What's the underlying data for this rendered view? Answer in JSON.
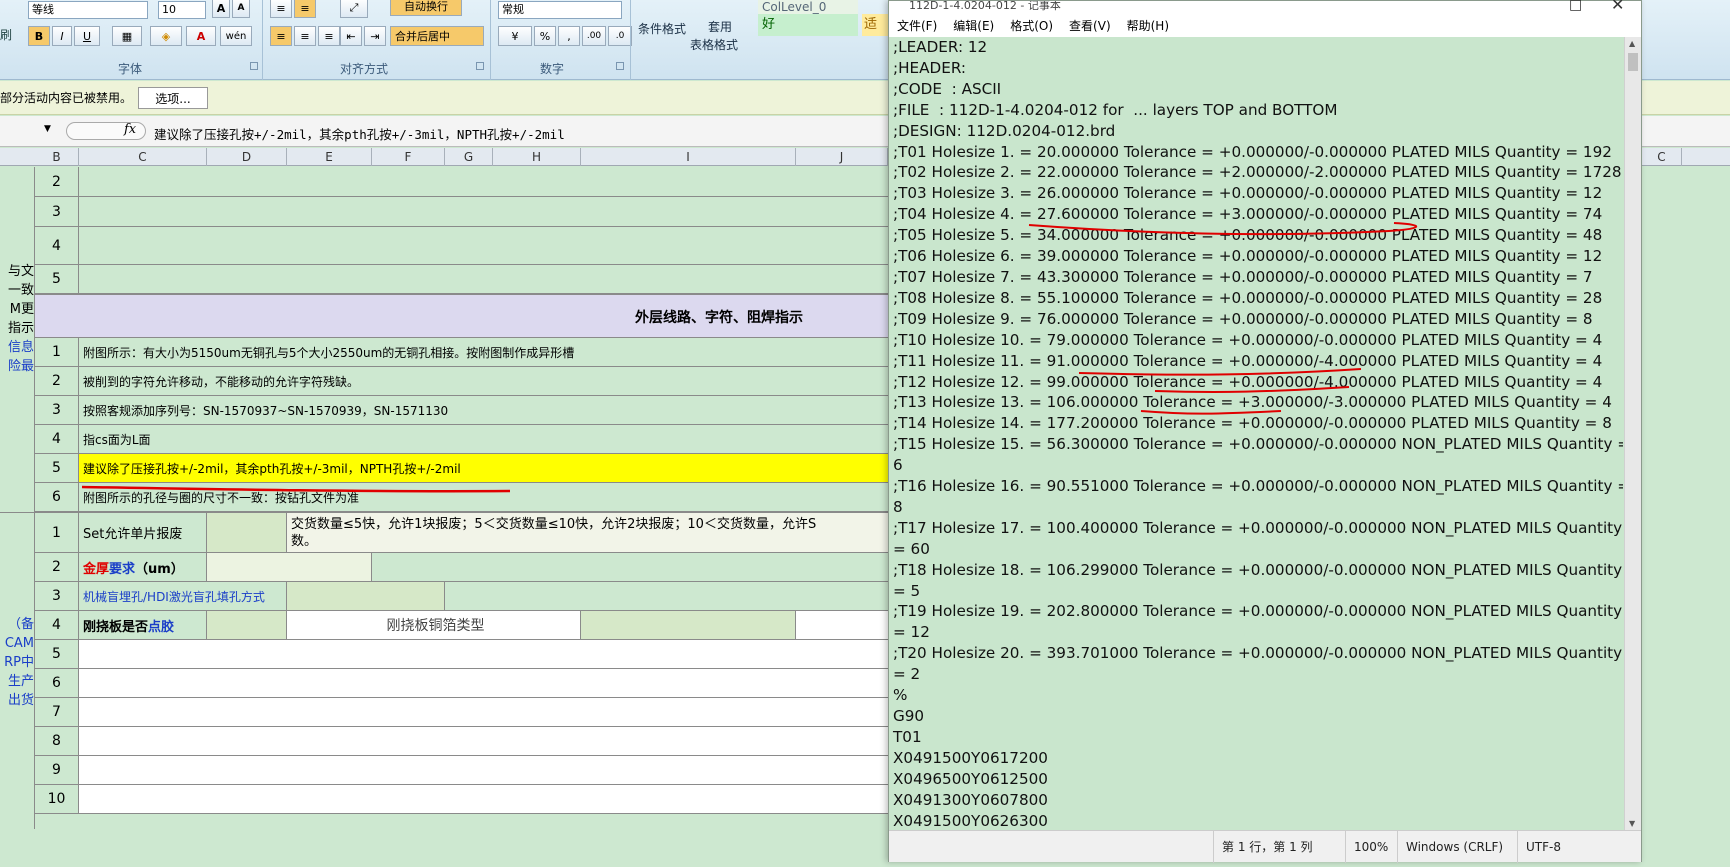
{
  "ribbon": {
    "font_name": "等线",
    "font_size": "10",
    "number_format": "常规",
    "wrap_text": "自动换行",
    "merge_center": "合并后居中",
    "conditional_format": "条件格式",
    "apply": "套用",
    "table_format": "表格格式",
    "style_name": "ColLevel_0",
    "style_good": "好",
    "style_fit": "适中",
    "brush": "刷",
    "group_font": "字体",
    "group_align": "对齐方式",
    "group_number": "数字",
    "bold": "B",
    "italic": "I",
    "underline": "U",
    "grow": "A",
    "shrink": "A",
    "percent": "%",
    "comma": ","
  },
  "message_bar": {
    "text": "部分活动内容已被禁用。",
    "options_button": "选项..."
  },
  "formula_bar": {
    "fx": "fx",
    "content": "建议除了压接孔按+/-2mil，其余pth孔按+/-3mil，NPTH孔按+/-2mil"
  },
  "columns": [
    "B",
    "C",
    "D",
    "E",
    "F",
    "G",
    "H",
    "I",
    "J",
    "C"
  ],
  "left_clip_text": {
    "block1": [
      "与文",
      "一致",
      "M更",
      "指示",
      "信息",
      "险最"
    ],
    "block2": [
      "（备",
      "CAM",
      "RP中",
      "生产",
      "出货"
    ]
  },
  "sheet": {
    "top_rows": [
      "2",
      "3",
      "4",
      "5"
    ],
    "section_title": "外层线路、字符、阻焊指示",
    "section_rows": [
      {
        "num": "1",
        "text": "附图所示：有大小为5150um无铜孔与5个大小2550um的无铜孔相接。按附图制作成异形槽"
      },
      {
        "num": "2",
        "text": "被削到的字符允许移动，不能移动的允许字符残缺。"
      },
      {
        "num": "3",
        "text": "按照客规添加序列号：SN-1570937~SN-1570939，SN-1571130"
      },
      {
        "num": "4",
        "text": "指cs面为L面"
      },
      {
        "num": "5",
        "text": "建议除了压接孔按+/-2mil，其余pth孔按+/-3mil，NPTH孔按+/-2mil"
      },
      {
        "num": "6",
        "text": "附图所示的孔径与圈的尺寸不一致：按钻孔文件为准"
      }
    ],
    "lower_rows": [
      {
        "num": "1",
        "label": "Set允许单片报废",
        "value": "交货数量≤5快，允许1块报废；5＜交货数量≤10快，允许2块报废；10＜交货数量，允许S",
        "value2": "数。"
      },
      {
        "num": "2",
        "label_red": "金厚",
        "label_blue": "要求",
        "label_rest": "（um）"
      },
      {
        "num": "3",
        "label": "机械盲埋孔/HDI激光盲孔填孔方式"
      },
      {
        "num": "4",
        "label_a": "刚挠板是否",
        "label_b": "点胶",
        "mid": "刚挠板铜箔类型"
      },
      {
        "num": "5"
      },
      {
        "num": "6"
      },
      {
        "num": "7"
      },
      {
        "num": "8"
      },
      {
        "num": "9"
      },
      {
        "num": "10"
      }
    ]
  },
  "notepad": {
    "title": "112D-1-4.0204-012 - 记事本",
    "menu": [
      "文件(F)",
      "编辑(E)",
      "格式(O)",
      "查看(V)",
      "帮助(H)"
    ],
    "lines": [
      ";LEADER: 12",
      ";HEADER:",
      ";CODE  : ASCII",
      ";FILE  : 112D-1-4.0204-012 for  ... layers TOP and BOTTOM",
      ";DESIGN: 112D.0204-012.brd",
      ";T01 Holesize 1. = 20.000000 Tolerance = +0.000000/-0.000000 PLATED MILS Quantity = 192",
      ";T02 Holesize 2. = 22.000000 Tolerance = +2.000000/-2.000000 PLATED MILS Quantity = 1728",
      ";T03 Holesize 3. = 26.000000 Tolerance = +0.000000/-0.000000 PLATED MILS Quantity = 12",
      ";T04 Holesize 4. = 27.600000 Tolerance = +3.000000/-0.000000 PLATED MILS Quantity = 74",
      ";T05 Holesize 5. = 34.000000 Tolerance = +0.000000/-0.000000 PLATED MILS Quantity = 48",
      ";T06 Holesize 6. = 39.000000 Tolerance = +0.000000/-0.000000 PLATED MILS Quantity = 12",
      ";T07 Holesize 7. = 43.300000 Tolerance = +0.000000/-0.000000 PLATED MILS Quantity = 7",
      ";T08 Holesize 8. = 55.100000 Tolerance = +0.000000/-0.000000 PLATED MILS Quantity = 28",
      ";T09 Holesize 9. = 76.000000 Tolerance = +0.000000/-0.000000 PLATED MILS Quantity = 8",
      ";T10 Holesize 10. = 79.000000 Tolerance = +0.000000/-0.000000 PLATED MILS Quantity = 4",
      ";T11 Holesize 11. = 91.000000 Tolerance = +0.000000/-4.000000 PLATED MILS Quantity = 4",
      ";T12 Holesize 12. = 99.000000 Tolerance = +0.000000/-4.000000 PLATED MILS Quantity = 4",
      ";T13 Holesize 13. = 106.000000 Tolerance = +3.000000/-3.000000 PLATED MILS Quantity = 4",
      ";T14 Holesize 14. = 177.200000 Tolerance = +0.000000/-0.000000 PLATED MILS Quantity = 8",
      ";T15 Holesize 15. = 56.300000 Tolerance = +0.000000/-0.000000 NON_PLATED MILS Quantity =",
      "6",
      ";T16 Holesize 16. = 90.551000 Tolerance = +0.000000/-0.000000 NON_PLATED MILS Quantity =",
      "8",
      ";T17 Holesize 17. = 100.400000 Tolerance = +0.000000/-0.000000 NON_PLATED MILS Quantity",
      "= 60",
      ";T18 Holesize 18. = 106.299000 Tolerance = +0.000000/-0.000000 NON_PLATED MILS Quantity",
      "= 5",
      ";T19 Holesize 19. = 202.800000 Tolerance = +0.000000/-0.000000 NON_PLATED MILS Quantity",
      "= 12",
      ";T20 Holesize 20. = 393.701000 Tolerance = +0.000000/-0.000000 NON_PLATED MILS Quantity",
      "= 2",
      "%",
      "G90",
      "T01",
      "X0491500Y0617200",
      "X0496500Y0612500",
      "X0491300Y0607800",
      "X0491500Y0626300"
    ],
    "status": {
      "position": "第 1 行，第 1 列",
      "zoom": "100%",
      "eol": "Windows (CRLF)",
      "encoding": "UTF-8"
    }
  }
}
